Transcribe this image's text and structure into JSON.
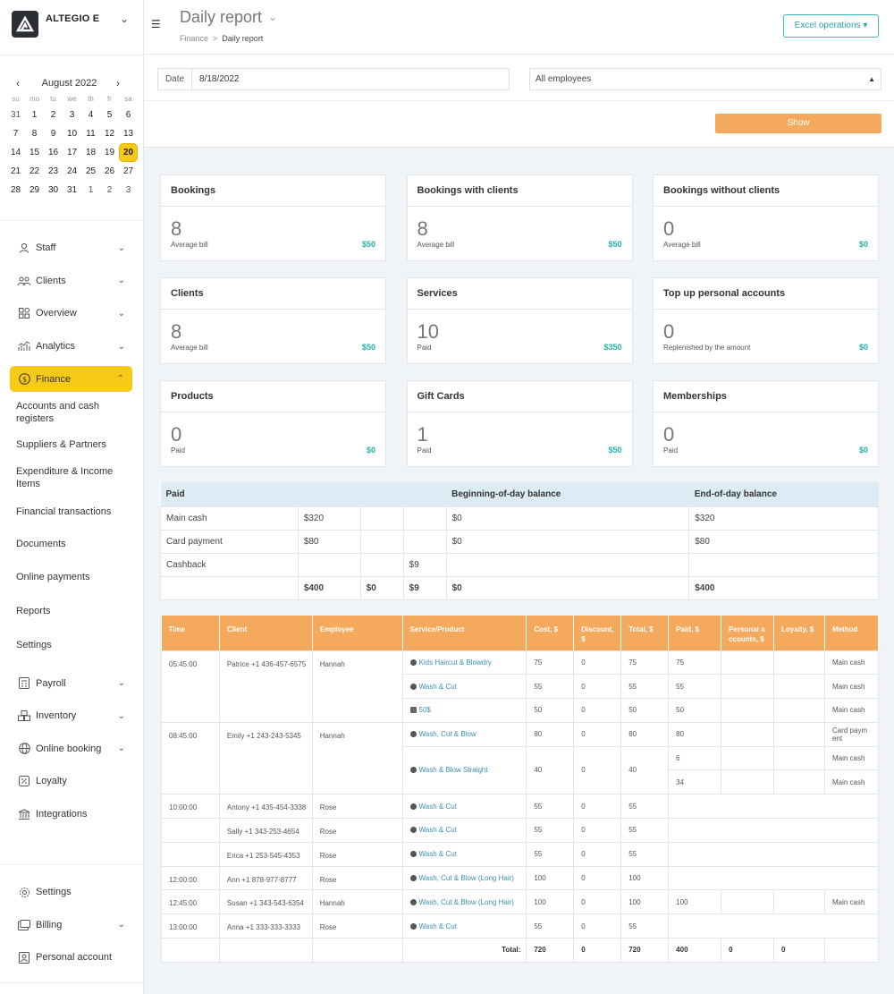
{
  "brand": {
    "name": "ALTEGIO E"
  },
  "calendar": {
    "month": "August 2022",
    "prev": "‹",
    "next": "›",
    "dow": [
      "su",
      "mo",
      "tu",
      "we",
      "th",
      "fr",
      "sa"
    ],
    "weeks": [
      [
        {
          "d": "31",
          "o": true
        },
        {
          "d": "1"
        },
        {
          "d": "2"
        },
        {
          "d": "3"
        },
        {
          "d": "4"
        },
        {
          "d": "5"
        },
        {
          "d": "6"
        }
      ],
      [
        {
          "d": "7"
        },
        {
          "d": "8"
        },
        {
          "d": "9"
        },
        {
          "d": "10"
        },
        {
          "d": "11"
        },
        {
          "d": "12"
        },
        {
          "d": "13"
        }
      ],
      [
        {
          "d": "14"
        },
        {
          "d": "15"
        },
        {
          "d": "16"
        },
        {
          "d": "17"
        },
        {
          "d": "18"
        },
        {
          "d": "19"
        },
        {
          "d": "20",
          "s": true
        }
      ],
      [
        {
          "d": "21"
        },
        {
          "d": "22"
        },
        {
          "d": "23"
        },
        {
          "d": "24"
        },
        {
          "d": "25"
        },
        {
          "d": "26"
        },
        {
          "d": "27"
        }
      ],
      [
        {
          "d": "28"
        },
        {
          "d": "29"
        },
        {
          "d": "30"
        },
        {
          "d": "31"
        },
        {
          "d": "1",
          "o": true
        },
        {
          "d": "2",
          "o": true
        },
        {
          "d": "3",
          "o": true
        }
      ]
    ]
  },
  "nav": {
    "staff": "Staff",
    "clients": "Clients",
    "overview": "Overview",
    "analytics": "Analytics",
    "finance": "Finance",
    "finance_sub": [
      "Accounts and cash registers",
      "Suppliers & Partners",
      "Expenditure & Income Items",
      "Financial transactions",
      "Documents",
      "Online payments",
      "Reports",
      "Settings"
    ],
    "payroll": "Payroll",
    "inventory": "Inventory",
    "online_booking": "Online booking",
    "loyalty": "Loyalty",
    "integrations": "Integrations",
    "settings": "Settings",
    "billing": "Billing",
    "personal_account": "Personal account"
  },
  "header": {
    "title": "Daily report",
    "crumb_root": "Finance",
    "crumb_sep": ">",
    "crumb_current": "Daily report",
    "excel_btn": "Excel operations ▾"
  },
  "filters": {
    "date_label": "Date",
    "date_value": "8/18/2022",
    "employees": "All employees",
    "show_btn": "Show"
  },
  "cards": [
    {
      "title": "Bookings",
      "value": "8",
      "sub": "Average bill",
      "amount": "$50"
    },
    {
      "title": "Bookings with clients",
      "value": "8",
      "sub": "Average bill",
      "amount": "$50"
    },
    {
      "title": "Bookings without clients",
      "value": "0",
      "sub": "Average bill",
      "amount": "$0"
    },
    {
      "title": "Clients",
      "value": "8",
      "sub": "Average bill",
      "amount": "$50"
    },
    {
      "title": "Services",
      "value": "10",
      "sub": "Paid",
      "amount": "$350"
    },
    {
      "title": "Top up personal accounts",
      "value": "0",
      "sub": "Replenished by the amount",
      "amount": "$0"
    },
    {
      "title": "Products",
      "value": "0",
      "sub": "Paid",
      "amount": "$0"
    },
    {
      "title": "Gift Cards",
      "value": "1",
      "sub": "Paid",
      "amount": "$50"
    },
    {
      "title": "Memberships",
      "value": "0",
      "sub": "Paid",
      "amount": "$0"
    }
  ],
  "balance": {
    "headers": [
      "Paid",
      "Beginning-of-day balance",
      "End-of-day balance"
    ],
    "rows": [
      [
        "Main cash",
        "$320",
        "",
        "",
        "$0",
        "$320"
      ],
      [
        "Card payment",
        "$80",
        "",
        "",
        "$0",
        "$80"
      ],
      [
        "Cashback",
        "",
        "",
        "$9",
        "",
        ""
      ]
    ],
    "total": [
      "",
      "$400",
      "$0",
      "$9",
      "$0",
      "$400"
    ]
  },
  "details": {
    "headers": [
      "Time",
      "Client",
      "Employee",
      "Service/Product",
      "Cost, $",
      "Discount, $",
      "Total, $",
      "Paid, $",
      "Personal a ccounts, $",
      "Loyalty, $",
      "Method"
    ],
    "groups": [
      {
        "time": "05:45:00",
        "client": "Patrice +1 436-457-6575",
        "employee": "Hannah",
        "lines": [
          {
            "svc": "Kids Haircut & Blowdry",
            "icon": "svc",
            "cost": "75",
            "disc": "0",
            "total": "75",
            "pays": [
              [
                "75",
                "Main cash"
              ]
            ]
          },
          {
            "svc": "Wash & Cut",
            "icon": "svc",
            "cost": "55",
            "disc": "0",
            "total": "55",
            "pays": [
              [
                "55",
                "Main cash"
              ]
            ]
          },
          {
            "svc": "50$",
            "icon": "box",
            "cost": "50",
            "disc": "0",
            "total": "50",
            "pays": [
              [
                "50",
                "Main cash"
              ]
            ]
          }
        ]
      },
      {
        "time": "08:45:00",
        "client": "Emily +1 243-243-5345",
        "employee": "Hannah",
        "lines": [
          {
            "svc": "Wash, Cut & Blow",
            "icon": "svc",
            "cost": "80",
            "disc": "0",
            "total": "80",
            "pays": [
              [
                "80",
                "Card paym ent"
              ]
            ]
          },
          {
            "svc": "Wash & Blow Straight",
            "icon": "svc",
            "cost": "40",
            "disc": "0",
            "total": "40",
            "pays": [
              [
                "6",
                "Main cash"
              ],
              [
                "34",
                "Main cash"
              ]
            ]
          }
        ]
      },
      {
        "time": "10:00:00",
        "client": "Antony +1 435-454-3338",
        "employee": "Rose",
        "lines": [
          {
            "svc": "Wash & Cut",
            "icon": "svc",
            "cost": "55",
            "disc": "0",
            "total": "55",
            "pays": []
          }
        ]
      },
      {
        "time": "",
        "client": "Sally +1 343-253-4654",
        "employee": "Rose",
        "lines": [
          {
            "svc": "Wash & Cut",
            "icon": "svc",
            "cost": "55",
            "disc": "0",
            "total": "55",
            "pays": []
          }
        ]
      },
      {
        "time": "",
        "client": "Erica +1 253-545-4353",
        "employee": "Rose",
        "lines": [
          {
            "svc": "Wash & Cut",
            "icon": "svc",
            "cost": "55",
            "disc": "0",
            "total": "55",
            "pays": []
          }
        ]
      },
      {
        "time": "12:00:00",
        "client": "Ann +1 878-977-8777",
        "employee": "Rose",
        "lines": [
          {
            "svc": "Wash, Cut & Blow (Long Hair)",
            "icon": "svc",
            "cost": "100",
            "disc": "0",
            "total": "100",
            "pays": []
          }
        ]
      },
      {
        "time": "12:45:00",
        "client": "Susan +1 343-543-6354",
        "employee": "Hannah",
        "lines": [
          {
            "svc": "Wash, Cut & Blow (Long Hair)",
            "icon": "svc",
            "cost": "100",
            "disc": "0",
            "total": "100",
            "pays": [
              [
                "100",
                "Main cash"
              ]
            ]
          }
        ]
      },
      {
        "time": "13:00:00",
        "client": "Anna +1 333-333-3333",
        "employee": "Rose",
        "lines": [
          {
            "svc": "Wash & Cut",
            "icon": "svc",
            "cost": "55",
            "disc": "0",
            "total": "55",
            "pays": []
          }
        ]
      }
    ],
    "total_label": "Total:",
    "totals": [
      "720",
      "0",
      "720",
      "400",
      "0",
      "0",
      ""
    ]
  }
}
